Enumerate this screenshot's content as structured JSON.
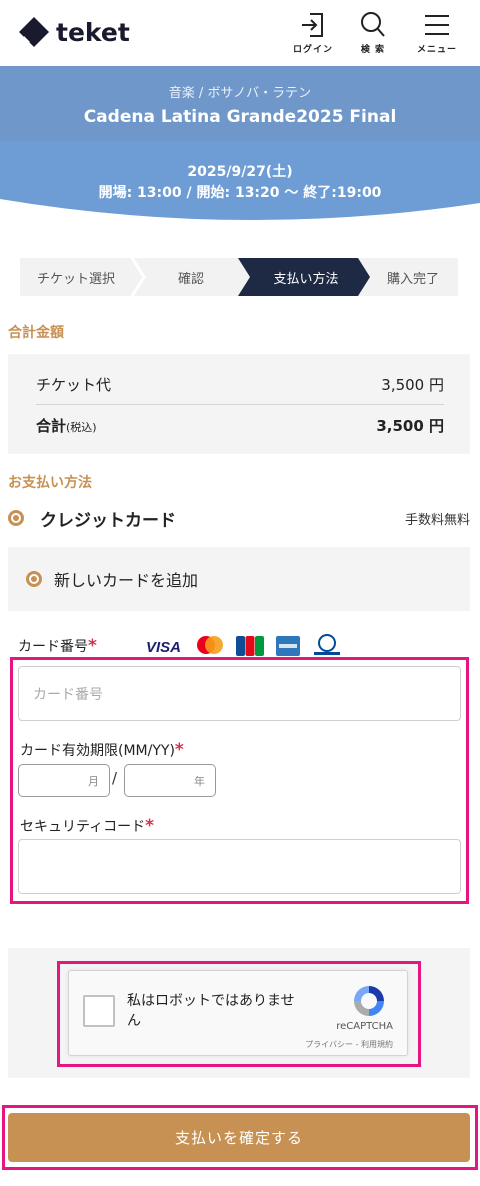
{
  "header": {
    "logo_text": "teket",
    "login_label": "ログイン",
    "search_label": "検 索",
    "menu_label": "メニュー"
  },
  "event": {
    "genre": "音楽 / ボサノバ・ラテン",
    "title": "Cadena Latina Grande2025 Final",
    "date": "2025/9/27(土)",
    "time": "開場: 13:00 / 開始: 13:20 〜 終了:19:00"
  },
  "steps": [
    {
      "label": "チケット選択",
      "active": false
    },
    {
      "label": "確認",
      "active": false
    },
    {
      "label": "支払い方法",
      "active": true
    },
    {
      "label": "購入完了",
      "active": false
    }
  ],
  "totals": {
    "section_title": "合計金額",
    "ticket_label": "チケット代",
    "ticket_value": "3,500 円",
    "total_label": "合計",
    "total_note": "(税込)",
    "total_value": "3,500 円"
  },
  "payment": {
    "section_title": "お支払い方法",
    "method_label": "クレジットカード",
    "fee_text": "手数料無料",
    "new_card_label": "新しいカードを追加"
  },
  "card_form": {
    "number_label": "カード番号",
    "number_placeholder": "カード番号",
    "expiry_label": "カード有効期限(MM/YY)",
    "month_placeholder": "月",
    "year_placeholder": "年",
    "separator": "/",
    "cvc_label": "セキュリティコード",
    "required_mark": "*",
    "brands": [
      "VISA",
      "Mastercard",
      "JCB",
      "American Express",
      "Diners Club"
    ]
  },
  "captcha": {
    "text": "私はロボットではありません",
    "brand": "reCAPTCHA",
    "links": "プライバシー - 利用規約"
  },
  "submit_label": "支払いを確定する",
  "colors": {
    "accent": "#c89154",
    "banner_top": "#6f97c9",
    "banner_bottom": "#6e9cd5",
    "active_step": "#1e2a44",
    "highlight": "#e4167f",
    "required": "#d0344a"
  }
}
